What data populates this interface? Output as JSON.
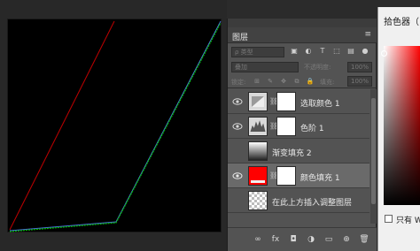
{
  "layers_panel": {
    "title": "图层",
    "menu_icon": "hamburger-icon",
    "filter": {
      "placeholder": "ρ 类型"
    },
    "blend_mode": "叠加",
    "opacity_label": "不透明度:",
    "opacity_value": "100%",
    "lock_label": "锁定:",
    "fill_label": "填充:",
    "fill_value": "100%",
    "layers": [
      {
        "name": "选取颜色 1",
        "number": "1",
        "thumb": "selective-color-adjustment-icon"
      },
      {
        "name": "色阶 1",
        "number": "1",
        "thumb": "levels-adjustment-icon"
      },
      {
        "name": "渐变填充 2",
        "thumb": "gradient-fill-thumbnail"
      },
      {
        "name": "颜色填充 1",
        "thumb": "red-color-fill-thumbnail",
        "color": "#ff0000",
        "selected": true
      },
      {
        "name": "在此上方插入调整图层",
        "thumb": "transparent-checkerboard-thumbnail"
      }
    ]
  },
  "color_picker": {
    "title": "拾色器（",
    "only_label": "只有 W"
  },
  "colors": {
    "red_line": "#c00000",
    "green_line": "#00c000",
    "blue_line": "#4a6fd8",
    "fill_red": "#ff0000"
  }
}
